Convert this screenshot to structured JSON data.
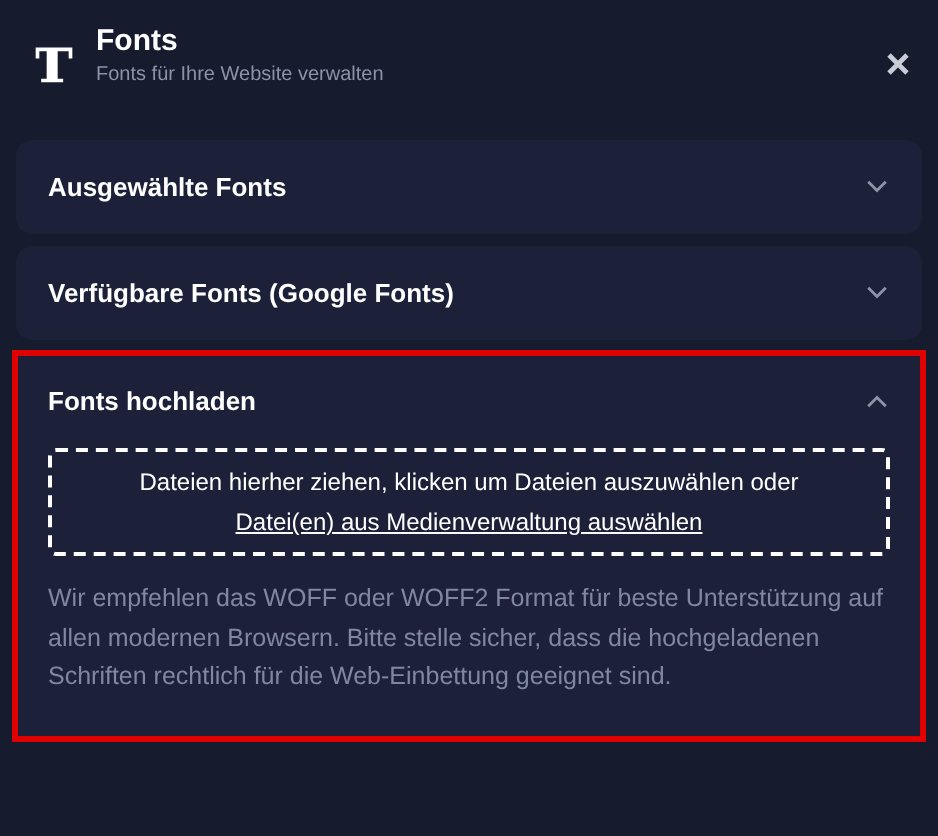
{
  "header": {
    "title": "Fonts",
    "subtitle": "Fonts für Ihre Website verwalten"
  },
  "sections": [
    {
      "title": "Ausgewählte Fonts",
      "expanded": false,
      "highlighted": false
    },
    {
      "title": "Verfügbare Fonts (Google Fonts)",
      "expanded": false,
      "highlighted": false
    },
    {
      "title": "Fonts hochladen",
      "expanded": true,
      "highlighted": true,
      "dropzone": {
        "text": "Dateien hierher ziehen, klicken um Dateien auszuwählen oder",
        "link": "Datei(en) aus Medienverwaltung auswählen"
      },
      "note": "Wir empfehlen das WOFF oder WOFF2 Format für beste Unterstützung auf allen modernen Browsern. Bitte stelle sicher, dass die hochgeladenen Schriften rechtlich für die Web-Einbettung geeignet sind."
    }
  ]
}
